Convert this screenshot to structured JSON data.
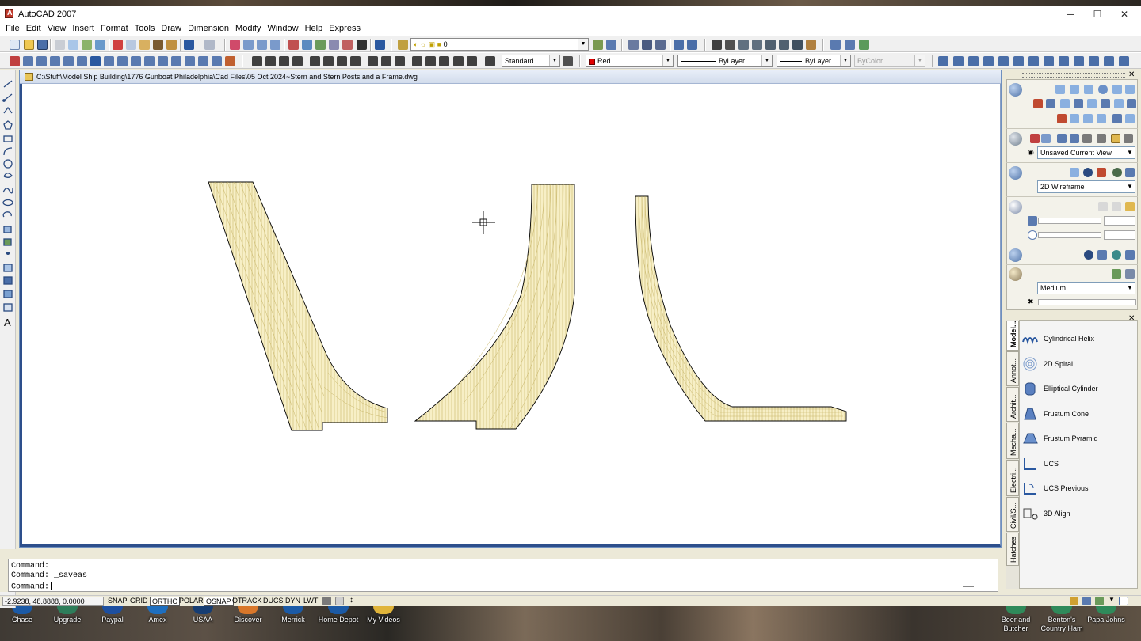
{
  "window": {
    "title": "AutoCAD 2007",
    "controls": {
      "minimize": "─",
      "maximize": "☐",
      "close": "✕"
    }
  },
  "menu": [
    "File",
    "Edit",
    "View",
    "Insert",
    "Format",
    "Tools",
    "Draw",
    "Dimension",
    "Modify",
    "Window",
    "Help",
    "Express"
  ],
  "toolbar": {
    "layer": "0",
    "text_style": "Standard",
    "color": "Red",
    "linetype": "ByLayer",
    "lineweight": "ByLayer",
    "plotstyle": "ByColor"
  },
  "drawing": {
    "path": "C:\\Stuff\\Model Ship Building\\1776 Gunboat Philadelphia\\Cad Files\\05 Oct 2024~Stern and Stern Posts and a Frame.dwg"
  },
  "command": {
    "history": [
      "Command:",
      "Command: _saveas"
    ],
    "prompt": "Command:"
  },
  "status": {
    "coords": "-2.9238, 48.8888, 0.0000",
    "buttons": [
      {
        "label": "SNAP",
        "on": false
      },
      {
        "label": "GRID",
        "on": false
      },
      {
        "label": "ORTHO",
        "on": true
      },
      {
        "label": "POLAR",
        "on": false
      },
      {
        "label": "OSNAP",
        "on": true
      },
      {
        "label": "OTRACK",
        "on": false
      },
      {
        "label": "DUCS",
        "on": false
      },
      {
        "label": "DYN",
        "on": false
      },
      {
        "label": "LWT",
        "on": false
      }
    ]
  },
  "dashboard": {
    "view": "Unsaved Current View",
    "visual_style": "2D Wireframe",
    "quality": "Medium"
  },
  "tool_palette": {
    "tabs": [
      "Model...",
      "Annot...",
      "Archit...",
      "Mecha...",
      "Electri...",
      "Civil/S...",
      "Hatches"
    ],
    "tools": [
      "Cylindrical Helix",
      "2D Spiral",
      "Elliptical Cylinder",
      "Frustum Cone",
      "Frustum Pyramid",
      "UCS",
      "UCS Previous",
      "3D Align"
    ]
  },
  "desktop": {
    "icons": [
      "Chase",
      "Upgrade",
      "Paypal",
      "Amex",
      "USAA",
      "Discover",
      "Merrick",
      "Home Depot",
      "My Videos"
    ],
    "right_icons": [
      "Boer and Butcher",
      "Benton's Country Ham",
      "Papa Johns"
    ]
  },
  "colors": {
    "wood_fill": "#f7efc6",
    "wood_lines": "#c9b76a",
    "canvas_border": "#2d4f8c"
  }
}
